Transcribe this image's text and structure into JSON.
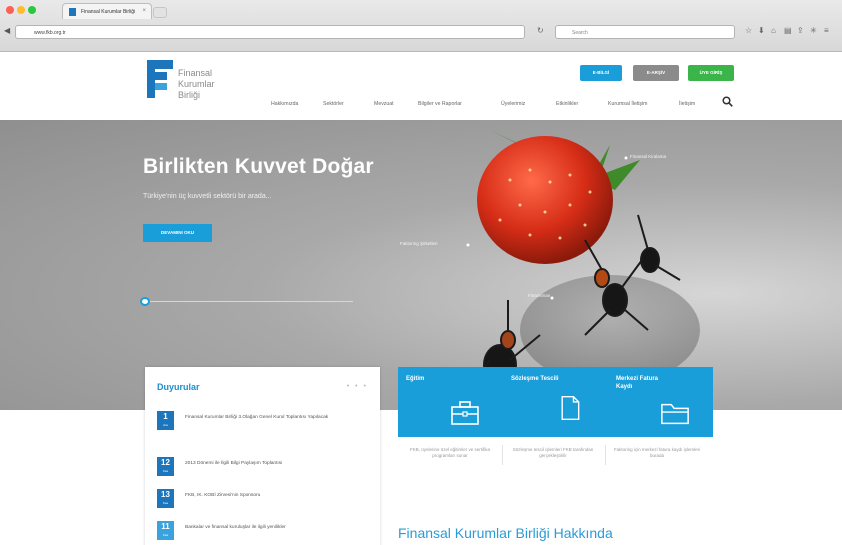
{
  "browser": {
    "tab_title": "Finansal Kurumlar Birliği",
    "url": "www.fkb.org.tr",
    "search_placeholder": "Search"
  },
  "header": {
    "logo_text": [
      "Finansal",
      "Kurumlar",
      "Birliği"
    ],
    "buttons": [
      {
        "label": "E-BİLGİ",
        "color": "#1a9ed9"
      },
      {
        "label": "E-ARŞİV",
        "color": "#8b8b8b"
      },
      {
        "label": "ÜYE GİRİŞ",
        "color": "#3bb54a"
      }
    ],
    "nav": [
      "Hakkımızda",
      "Sektörler",
      "Mevzuat",
      "Bilgiler ve Raporlar",
      "Üyelerimiz",
      "Etkinlikler",
      "Kurumsal İletişim",
      "İletişim"
    ]
  },
  "hero": {
    "title": "Birlikten Kuvvet Doğar",
    "subtitle": "Türkiye'nin üç kuvvetli sektörü bir arada...",
    "cta_label": "DEVAMINI OKU",
    "annotations": [
      "Finansal Kiralama",
      "Faktoring Şirketleri",
      "Finansman"
    ]
  },
  "announcements": {
    "title": "Duyurular",
    "items": [
      {
        "day": "1",
        "month": "Ara",
        "text": "Finansal Kurumlar Birliği 3.Olağan Genel Kurul Toplantısı Yapılacak"
      },
      {
        "day": "12",
        "month": "Kas",
        "text": "2013 Dönemi ile İlgili Bilgi Paylaşım Toplantısı"
      },
      {
        "day": "13",
        "month": "Kas",
        "text": "FKB, IK. KOBİ Zirvesi'nin Sponsoru"
      },
      {
        "day": "11",
        "month": "Kas",
        "text": "Bankalar ve finansal kuruluşlar ile ilgili yenilikler"
      }
    ]
  },
  "features": [
    {
      "label": "Eğitim",
      "icon": "briefcase-icon",
      "desc": "FKB, üyelerine özel eğitimler ve sertifika programları sunar"
    },
    {
      "label": "Sözleşme Tescili",
      "icon": "document-icon",
      "desc": "Sözleşme tescil işlemleri FKB tarafından gerçekleştirilir"
    },
    {
      "label": "Merkezi Fatura Kaydı",
      "icon": "folder-icon",
      "desc": "Faktoring için merkezi fatura kaydı işlemleri burada"
    }
  ],
  "about_title": "Finansal Kurumlar Birliği Hakkında",
  "colors": {
    "accent": "#1a9ed9",
    "brand": "#1d75bb",
    "green": "#3bb54a"
  }
}
